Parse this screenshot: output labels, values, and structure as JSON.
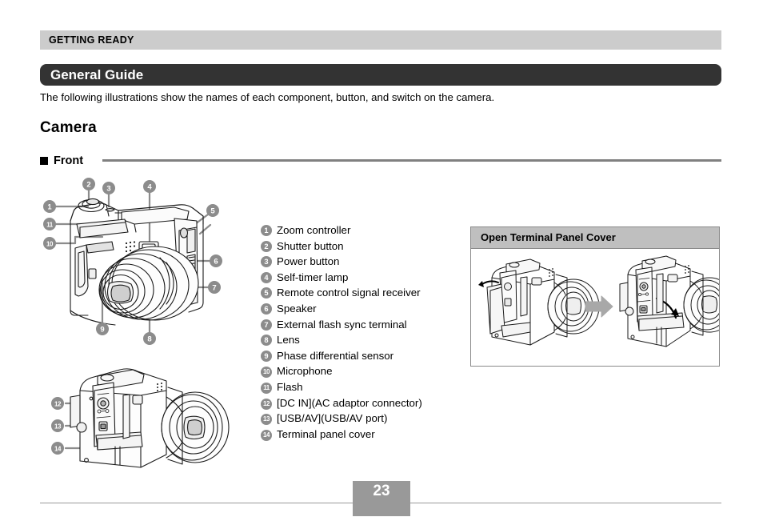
{
  "header": {
    "chapter": "GETTING READY",
    "section_title": "General Guide",
    "intro": "The following illustrations show the names of each component, button, and switch on the camera.",
    "camera_heading": "Camera",
    "subsection": "Front"
  },
  "parts": [
    {
      "num": "1",
      "label": "Zoom controller"
    },
    {
      "num": "2",
      "label": "Shutter button"
    },
    {
      "num": "3",
      "label": "Power button"
    },
    {
      "num": "4",
      "label": "Self-timer lamp"
    },
    {
      "num": "5",
      "label": "Remote control signal receiver"
    },
    {
      "num": "6",
      "label": "Speaker"
    },
    {
      "num": "7",
      "label": "External flash sync terminal"
    },
    {
      "num": "8",
      "label": "Lens"
    },
    {
      "num": "9",
      "label": "Phase differential sensor"
    },
    {
      "num": "10",
      "label": "Microphone"
    },
    {
      "num": "11",
      "label": "Flash"
    },
    {
      "num": "12",
      "label": "[DC IN](AC adaptor connector)"
    },
    {
      "num": "13",
      "label": "[USB/AV](USB/AV port)"
    },
    {
      "num": "14",
      "label": "Terminal panel cover"
    }
  ],
  "callout_box": {
    "title": "Open Terminal Panel Cover"
  },
  "front_illustration": {
    "callouts": [
      "1",
      "2",
      "3",
      "4",
      "5",
      "6",
      "7",
      "8",
      "9",
      "10",
      "11"
    ]
  },
  "bottom_illustration": {
    "callouts": [
      "12",
      "13",
      "14"
    ],
    "port_labels": [
      "DC IN",
      "USB/AV"
    ]
  },
  "footer": {
    "page_number": "23"
  },
  "colors": {
    "chapter_bar": "#cccccc",
    "section_pill": "#333333",
    "callout_circle": "#8c8c8c",
    "rule": "#808080",
    "box_header": "#bfbfbf",
    "page_box": "#999999"
  }
}
